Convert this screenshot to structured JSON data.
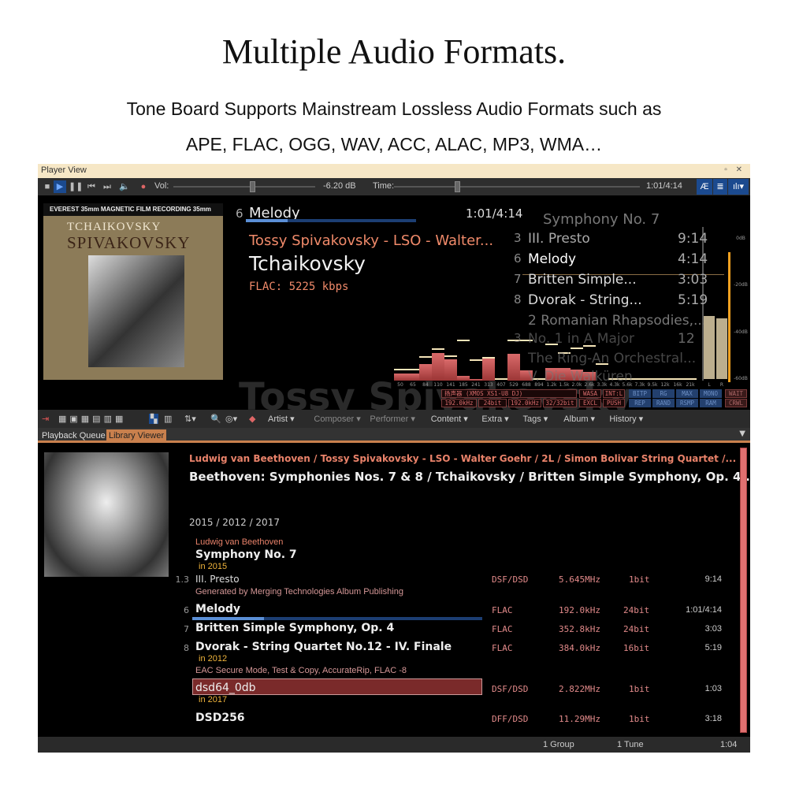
{
  "headline": "Multiple Audio Formats.",
  "subline1": "Tone Board Supports Mainstream Lossless Audio Formats such as",
  "subline2": "APE, FLAC, OGG, WAV, ACC, ALAC, MP3, WMA…",
  "window": {
    "title": "Player View",
    "controls": "▫ ✕"
  },
  "controls": {
    "vol_label": "Vol:",
    "vol_value": "-6.20 dB",
    "time_label": "Time:",
    "time_value": "1:01/4:14",
    "volume_fraction": 0.54,
    "time_fraction": 0.246,
    "icons": [
      "stop-icon",
      "play-icon",
      "pause-icon",
      "previous-icon",
      "next-icon",
      "mute-icon",
      "record-icon"
    ]
  },
  "now_playing": {
    "track_no": "6",
    "title": "Melody",
    "time": "1:01/4:14",
    "artist": "Tossy Spivakovsky - LSO - Walter...",
    "composer": "Tchaikovsky",
    "format": "FLAC: 5225 kbps",
    "progress": 0.246,
    "watermark": "Tossy Spivakovsky"
  },
  "album_art": {
    "label": "EVEREST   35mm MAGNETIC FILM RECORDING 35mm",
    "line1": "TCHAIKOVSKY",
    "line2": "SPIVAKOVSKY"
  },
  "playlist": {
    "album": "Symphony No. 7",
    "items": [
      {
        "n": "3",
        "title": "III. Presto",
        "dur": "9:14"
      },
      {
        "n": "6",
        "title": "Melody",
        "dur": "4:14"
      },
      {
        "n": "7",
        "title": "Britten Simple...",
        "dur": "3:03"
      },
      {
        "n": "8",
        "title": "Dvorak - String...",
        "dur": "5:19"
      },
      {
        "n": "",
        "title": "2 Romanian Rhapsodies,...",
        "dur": ""
      },
      {
        "n": "3",
        "title": "No. 1 in A Major",
        "dur": "12"
      },
      {
        "n": "",
        "title": "The Ring-An Orchestral...",
        "dur": ""
      },
      {
        "n": "",
        "title": "V. Die Walküren",
        "dur": ""
      }
    ]
  },
  "spectrum": {
    "bands": [
      "50",
      "65",
      "84",
      "110",
      "141",
      "185",
      "241",
      "313",
      "407",
      "529",
      "688",
      "894",
      "1.2k",
      "1.5k",
      "2.0k",
      "2.6k",
      "3.3k",
      "4.3k",
      "5.6k",
      "7.3k",
      "9.5k",
      "12k",
      "16k",
      "21k"
    ],
    "levels": [
      0.11,
      0.11,
      0.26,
      0.44,
      0.34,
      0.08,
      0.03,
      0.35,
      0,
      0.43,
      0.16,
      0,
      0.2,
      0.2,
      0.18,
      0.14,
      0,
      0,
      0,
      0,
      0,
      0,
      0,
      0
    ],
    "peaks": [
      0.16,
      0.16,
      0.36,
      0.49,
      0.38,
      0.63,
      0.31,
      0.35,
      0.01,
      0.63,
      0.63,
      0.01,
      0.56,
      0.43,
      0.5,
      0.54,
      0.25,
      0.01,
      0.01,
      0.01,
      0.01,
      0.01,
      0.01,
      0.01
    ],
    "vu_labels": [
      "L",
      "R"
    ],
    "vu_db": [
      -33,
      -34
    ],
    "db_scale": [
      "0dB",
      "-20dB",
      "-40dB",
      "-60dB"
    ]
  },
  "device": {
    "name": "扬声器 (XMOS XS1-U8 DJ)",
    "rate_in": "192.0kHz",
    "bits_in": "24bit",
    "rate_out": "192.0kHz",
    "bits_out": "32/32bit",
    "wasa": "WASA",
    "int": "INT:L",
    "excl": "EXCL",
    "push": "PUSH",
    "flags": [
      "BITP",
      "RG",
      "MAX",
      "MONO",
      "REP",
      "RAND",
      "RSMP",
      "RAM"
    ],
    "wait": "WAIT",
    "crwl": "CRWL"
  },
  "toolbar": {
    "menus": [
      "Artist ▾",
      "Composer ▾",
      "Performer ▾",
      "Content ▾",
      "Extra ▾",
      "Tags ▾",
      "Album ▾",
      "History ▾"
    ]
  },
  "tabs": [
    {
      "label": "Playback Queue"
    },
    {
      "label": "Library Viewer",
      "active": true
    }
  ],
  "library": {
    "artists": "Ludwig van Beethoven / Tossy Spivakovsky - LSO - Walter Goehr / 2L / Simon Bolivar String Quartet /...",
    "album": "Beethoven: Symphonies Nos. 7 & 8 / Tchaikovsky / Britten Simple Symphony, Op. 4...",
    "years": "2015 / 2012 / 2017",
    "group_artist": "Ludwig van Beethoven",
    "group_title": "Symphony No. 7",
    "rows": [
      {
        "n": "1.3",
        "title": "III. Presto",
        "year": "in 2015",
        "note": "Generated by Merging Technologies Album Publishing",
        "fmt": "DSF/DSD",
        "rate": "5.645MHz",
        "bits": "1bit",
        "dur": "9:14"
      },
      {
        "n": "6",
        "title": "Melody",
        "fmt": "FLAC",
        "rate": "192.0kHz",
        "bits": "24bit",
        "dur": "1:01/4:14",
        "progress": 0.246
      },
      {
        "n": "7",
        "title": "Britten Simple Symphony, Op. 4",
        "fmt": "FLAC",
        "rate": "352.8kHz",
        "bits": "24bit",
        "dur": "3:03"
      },
      {
        "n": "8",
        "title": "Dvorak - String Quartet No.12 - IV. Finale",
        "year": "in 2012",
        "note": "EAC Secure Mode, Test & Copy, AccurateRip, FLAC -8",
        "fmt": "FLAC",
        "rate": "384.0kHz",
        "bits": "16bit",
        "dur": "5:19"
      },
      {
        "n": "",
        "title": "dsd64_0db",
        "year": "in 2017",
        "fmt": "DSF/DSD",
        "rate": "2.822MHz",
        "bits": "1bit",
        "dur": "1:03"
      },
      {
        "n": "",
        "title": "DSD256",
        "fmt": "DFF/DSD",
        "rate": "11.29MHz",
        "bits": "1bit",
        "dur": "3:18"
      }
    ]
  },
  "status": {
    "groups": "1 Group",
    "tunes": "1 Tune",
    "time": "1:04"
  },
  "colors": {
    "accent_red": "#e07a6a",
    "progress_blue": "#1c3e73",
    "tab_active": "#c9804d",
    "titlebar": "#f6e7c6",
    "vu_orange": "#f0a020"
  }
}
